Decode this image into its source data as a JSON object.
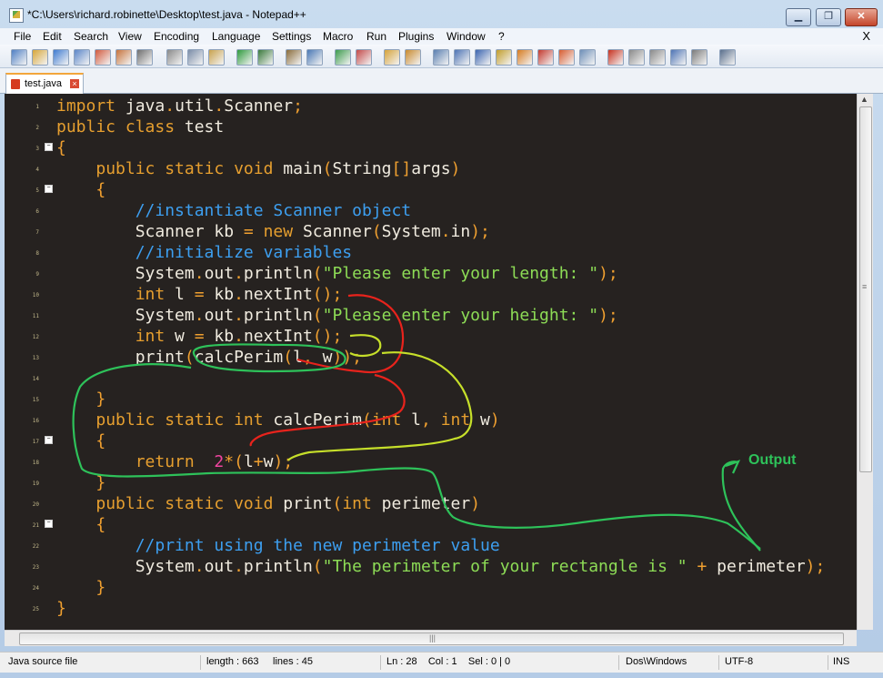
{
  "window": {
    "title": "*C:\\Users\\richard.robinette\\Desktop\\test.java - Notepad++",
    "minimize_glyph": "▁",
    "restore_glyph": "❐",
    "close_glyph": "✕"
  },
  "menu": {
    "items": [
      "File",
      "Edit",
      "Search",
      "View",
      "Encoding",
      "Language",
      "Settings",
      "Macro",
      "Run",
      "Plugins",
      "Window",
      "?"
    ],
    "close_glyph": "X"
  },
  "toolbar": {
    "icons": [
      "new-file-icon",
      "open-file-icon",
      "save-icon",
      "save-all-icon",
      "close-icon",
      "close-all-icon",
      "print-icon",
      "cut-icon",
      "copy-icon",
      "paste-icon",
      "undo-icon",
      "redo-icon",
      "find-icon",
      "replace-icon",
      "zoom-in-icon",
      "zoom-out-icon",
      "sync-vertical-icon",
      "sync-horizontal-icon",
      "word-wrap-icon",
      "show-all-chars-icon",
      "indent-guide-icon",
      "function-list-icon",
      "user-lang-icon",
      "doc-map-icon",
      "folder-icon",
      "monitor-icon",
      "record-macro-icon",
      "stop-macro-icon",
      "play-macro-icon",
      "run-macro-icon",
      "save-macro-icon",
      "launch-icon"
    ]
  },
  "tab": {
    "label": "test.java",
    "close_glyph": "×"
  },
  "editor": {
    "line_numbers": [
      "1",
      "2",
      "3",
      "4",
      "5",
      "6",
      "7",
      "8",
      "9",
      "10",
      "11",
      "12",
      "13",
      "14",
      "15",
      "16",
      "17",
      "18",
      "19",
      "20",
      "21",
      "22",
      "23",
      "24",
      "25"
    ],
    "lines": [
      [
        [
          "kw",
          "import"
        ],
        [
          "tx",
          " java"
        ],
        [
          "op",
          "."
        ],
        [
          "tx",
          "util"
        ],
        [
          "op",
          "."
        ],
        [
          "tx",
          "Scanner"
        ],
        [
          "op",
          ";"
        ]
      ],
      [
        [
          "kw",
          "public class"
        ],
        [
          "tx",
          " test"
        ]
      ],
      [
        [
          "op",
          "{"
        ]
      ],
      [
        [
          "tx",
          "    "
        ],
        [
          "kw",
          "public static void"
        ],
        [
          "tx",
          " main"
        ],
        [
          "op",
          "("
        ],
        [
          "tx",
          "String"
        ],
        [
          "op",
          "[]"
        ],
        [
          "tx",
          "args"
        ],
        [
          "op",
          ")"
        ]
      ],
      [
        [
          "tx",
          "    "
        ],
        [
          "op",
          "{"
        ]
      ],
      [
        [
          "tx",
          "        "
        ],
        [
          "cm",
          "//instantiate Scanner object"
        ]
      ],
      [
        [
          "tx",
          "        Scanner kb "
        ],
        [
          "op",
          "="
        ],
        [
          "tx",
          " "
        ],
        [
          "kw",
          "new"
        ],
        [
          "tx",
          " Scanner"
        ],
        [
          "op",
          "("
        ],
        [
          "tx",
          "System"
        ],
        [
          "op",
          "."
        ],
        [
          "tx",
          "in"
        ],
        [
          "op",
          ");"
        ]
      ],
      [
        [
          "tx",
          "        "
        ],
        [
          "cm",
          "//initialize variables"
        ]
      ],
      [
        [
          "tx",
          "        System"
        ],
        [
          "op",
          "."
        ],
        [
          "tx",
          "out"
        ],
        [
          "op",
          "."
        ],
        [
          "tx",
          "println"
        ],
        [
          "op",
          "("
        ],
        [
          "str",
          "\"Please enter your length: \""
        ],
        [
          "op",
          ");"
        ]
      ],
      [
        [
          "tx",
          "        "
        ],
        [
          "kw",
          "int"
        ],
        [
          "tx",
          " l "
        ],
        [
          "op",
          "="
        ],
        [
          "tx",
          " kb"
        ],
        [
          "op",
          "."
        ],
        [
          "tx",
          "nextInt"
        ],
        [
          "op",
          "();"
        ]
      ],
      [
        [
          "tx",
          "        System"
        ],
        [
          "op",
          "."
        ],
        [
          "tx",
          "out"
        ],
        [
          "op",
          "."
        ],
        [
          "tx",
          "println"
        ],
        [
          "op",
          "("
        ],
        [
          "str",
          "\"Please enter your height: \""
        ],
        [
          "op",
          ");"
        ]
      ],
      [
        [
          "tx",
          "        "
        ],
        [
          "kw",
          "int"
        ],
        [
          "tx",
          " w "
        ],
        [
          "op",
          "="
        ],
        [
          "tx",
          " kb"
        ],
        [
          "op",
          "."
        ],
        [
          "tx",
          "nextInt"
        ],
        [
          "op",
          "();"
        ]
      ],
      [
        [
          "tx",
          "        print"
        ],
        [
          "op",
          "("
        ],
        [
          "tx",
          "calcPerim"
        ],
        [
          "op",
          "("
        ],
        [
          "tx",
          "l"
        ],
        [
          "op",
          ","
        ],
        [
          "tx",
          " w"
        ],
        [
          "op",
          "));"
        ]
      ],
      [],
      [
        [
          "tx",
          "    "
        ],
        [
          "op",
          "}"
        ]
      ],
      [
        [
          "tx",
          "    "
        ],
        [
          "kw",
          "public static int"
        ],
        [
          "tx",
          " calcPerim"
        ],
        [
          "op",
          "("
        ],
        [
          "kw",
          "int"
        ],
        [
          "tx",
          " l"
        ],
        [
          "op",
          ","
        ],
        [
          "tx",
          " "
        ],
        [
          "kw",
          "int"
        ],
        [
          "tx",
          " w"
        ],
        [
          "op",
          ")"
        ]
      ],
      [
        [
          "tx",
          "    "
        ],
        [
          "op",
          "{"
        ]
      ],
      [
        [
          "tx",
          "        "
        ],
        [
          "kw",
          "return"
        ],
        [
          "tx",
          "  "
        ],
        [
          "num",
          "2"
        ],
        [
          "op",
          "*("
        ],
        [
          "tx",
          "l"
        ],
        [
          "op",
          "+"
        ],
        [
          "tx",
          "w"
        ],
        [
          "op",
          ");"
        ]
      ],
      [
        [
          "tx",
          "    "
        ],
        [
          "op",
          "}"
        ]
      ],
      [
        [
          "tx",
          "    "
        ],
        [
          "kw",
          "public static void"
        ],
        [
          "tx",
          " print"
        ],
        [
          "op",
          "("
        ],
        [
          "kw",
          "int"
        ],
        [
          "tx",
          " perimeter"
        ],
        [
          "op",
          ")"
        ]
      ],
      [
        [
          "tx",
          "    "
        ],
        [
          "op",
          "{"
        ]
      ],
      [
        [
          "tx",
          "        "
        ],
        [
          "cm",
          "//print using the new perimeter value"
        ]
      ],
      [
        [
          "tx",
          "        System"
        ],
        [
          "op",
          "."
        ],
        [
          "tx",
          "out"
        ],
        [
          "op",
          "."
        ],
        [
          "tx",
          "println"
        ],
        [
          "op",
          "("
        ],
        [
          "str",
          "\"The perimeter of your rectangle is \""
        ],
        [
          "tx",
          " "
        ],
        [
          "op",
          "+"
        ],
        [
          "tx",
          " perimeter"
        ],
        [
          "op",
          ");"
        ]
      ],
      [
        [
          "tx",
          "    "
        ],
        [
          "op",
          "}"
        ]
      ],
      [
        [
          "op",
          "}"
        ]
      ]
    ],
    "fold_lines": [
      3,
      5,
      17,
      21
    ],
    "annotation_label": "Output",
    "scroll_arrow_glyph": "▲",
    "scroll_grip_glyph": "≡",
    "hscroll_grip_glyph": "|||"
  },
  "statusbar": {
    "file_type": "Java source file",
    "length": "length : 663",
    "lines": "lines : 45",
    "position": "Ln : 28    Col : 1    Sel : 0 | 0",
    "eol": "Dos\\Windows",
    "encoding": "UTF-8",
    "mode": "INS"
  },
  "colors": {
    "editor_bg": "#262220",
    "keyword": "#e69f2f",
    "text": "#f0ebdf",
    "comment": "#3d9ff0",
    "string": "#8ddc56",
    "number": "#f045a0",
    "annotation_red": "#e8231c",
    "annotation_yellow": "#c6df2a",
    "annotation_green": "#2ec25a"
  }
}
